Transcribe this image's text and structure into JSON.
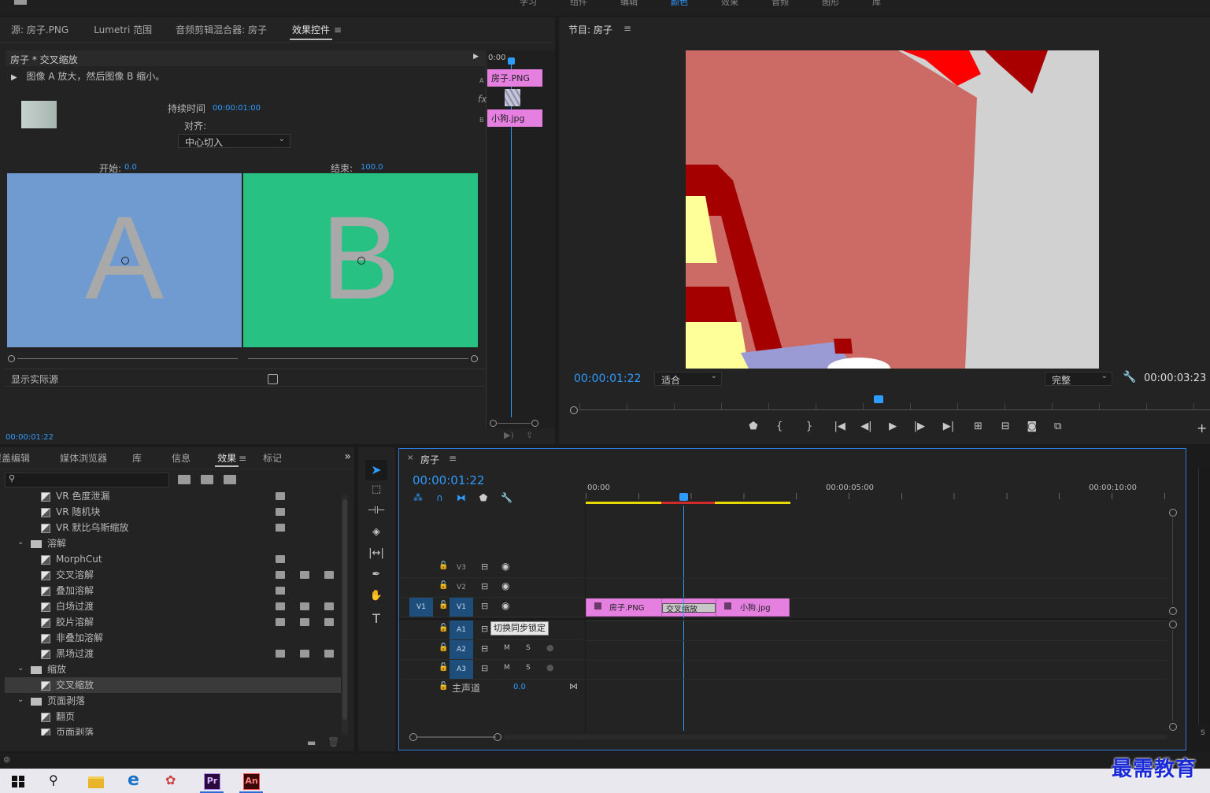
{
  "top_menu": {
    "items": [
      "学习",
      "组件",
      "编辑",
      "颜色",
      "效果",
      "音频",
      "图形",
      "库"
    ],
    "more": "»"
  },
  "source_panel": {
    "tabs": [
      "源: 房子.PNG",
      "Lumetri 范围",
      "音频剪辑混合器: 房子",
      "效果控件"
    ],
    "menu_icon": "≡",
    "clip_title": "房子 * 交叉缩放",
    "description": "图像 A 放大，然后图像 B 缩小。",
    "duration_label": "持续时间",
    "duration_value": "00:00:01:00",
    "align_label": "对齐:",
    "align_value": "中心切入",
    "start_label": "开始:",
    "start_value": "0.0",
    "end_label": "结束:",
    "end_value": "100.0",
    "preview_a": "A",
    "preview_b": "B",
    "show_source_label": "显示实际源",
    "timecode": "00:00:01:22",
    "mini_time": "0:00",
    "mini_clip_a": "房子.PNG",
    "mini_clip_b": "小狗.jpg",
    "track_a": "A",
    "track_b": "B",
    "fx": "fx",
    "colors": {
      "a_bg": "#6f9bd1",
      "b_bg": "#27c183",
      "clip": "#e57fe0"
    }
  },
  "program_panel": {
    "title": "节目: 房子",
    "menu_icon": "≡",
    "timecode": "00:00:01:22",
    "fit_value": "适合",
    "quality_value": "完整",
    "duration": "00:00:03:23"
  },
  "effects_panel": {
    "tabs": [
      "覆盖编辑",
      "媒体浏览器",
      "库",
      "信息",
      "效果",
      "标记"
    ],
    "menu_icon": "≡",
    "more": "»",
    "toolbar_icons": [
      "accel-icon",
      "32-bit-icon",
      "yuv-icon"
    ],
    "items": [
      {
        "label": "VR 色度泄漏",
        "level": 2,
        "badges": [
          1,
          0,
          0
        ]
      },
      {
        "label": "VR 随机块",
        "level": 2,
        "badges": [
          1,
          0,
          0
        ]
      },
      {
        "label": "VR 默比乌斯缩放",
        "level": 2,
        "badges": [
          1,
          0,
          0
        ]
      },
      {
        "label": "溶解",
        "level": 1,
        "folder": true
      },
      {
        "label": "MorphCut",
        "level": 2,
        "badges": [
          1,
          0,
          0
        ]
      },
      {
        "label": "交叉溶解",
        "level": 2,
        "badges": [
          1,
          1,
          1
        ]
      },
      {
        "label": "叠加溶解",
        "level": 2,
        "badges": [
          1,
          0,
          0
        ]
      },
      {
        "label": "白场过渡",
        "level": 2,
        "badges": [
          1,
          1,
          1
        ]
      },
      {
        "label": "胶片溶解",
        "level": 2,
        "badges": [
          1,
          1,
          1
        ]
      },
      {
        "label": "非叠加溶解",
        "level": 2,
        "badges": [
          0,
          0,
          0
        ]
      },
      {
        "label": "黑场过渡",
        "level": 2,
        "badges": [
          1,
          1,
          1
        ]
      },
      {
        "label": "缩放",
        "level": 1,
        "folder": true
      },
      {
        "label": "交叉缩放",
        "level": 2,
        "badges": [
          0,
          0,
          0
        ],
        "selected": true
      },
      {
        "label": "页面剥落",
        "level": 1,
        "folder": true
      },
      {
        "label": "翻页",
        "level": 2,
        "badges": [
          0,
          0,
          0
        ]
      },
      {
        "label": "页面剥落",
        "level": 2,
        "badges": [
          0,
          0,
          0
        ]
      }
    ]
  },
  "timeline": {
    "tab": "房子",
    "close": "×",
    "menu_icon": "≡",
    "timecode": "00:00:01:22",
    "ruler": [
      "00:00",
      "00:00:05:00",
      "00:00:10:00"
    ],
    "tracks": [
      {
        "name": "V3",
        "type": "video"
      },
      {
        "name": "V2",
        "type": "video"
      },
      {
        "name": "V1",
        "type": "video",
        "source": "V1"
      },
      {
        "name": "A1",
        "type": "audio"
      },
      {
        "name": "A2",
        "type": "audio"
      },
      {
        "name": "A3",
        "type": "audio"
      }
    ],
    "m": "M",
    "s": "S",
    "master_label": "主声道",
    "master_value": "0.0",
    "clip1": "房子.PNG",
    "transition": "交叉缩放",
    "clip2": "小狗.jpg",
    "tooltip": "切换同步锁定"
  },
  "watermark": "最需教育",
  "taskbar": {
    "apps": [
      "windows-start-icon",
      "search-icon",
      "file-explorer-icon",
      "edge-icon",
      "paint-icon",
      "premiere-icon",
      "animate-icon"
    ],
    "pr": "Pr",
    "an": "An"
  }
}
